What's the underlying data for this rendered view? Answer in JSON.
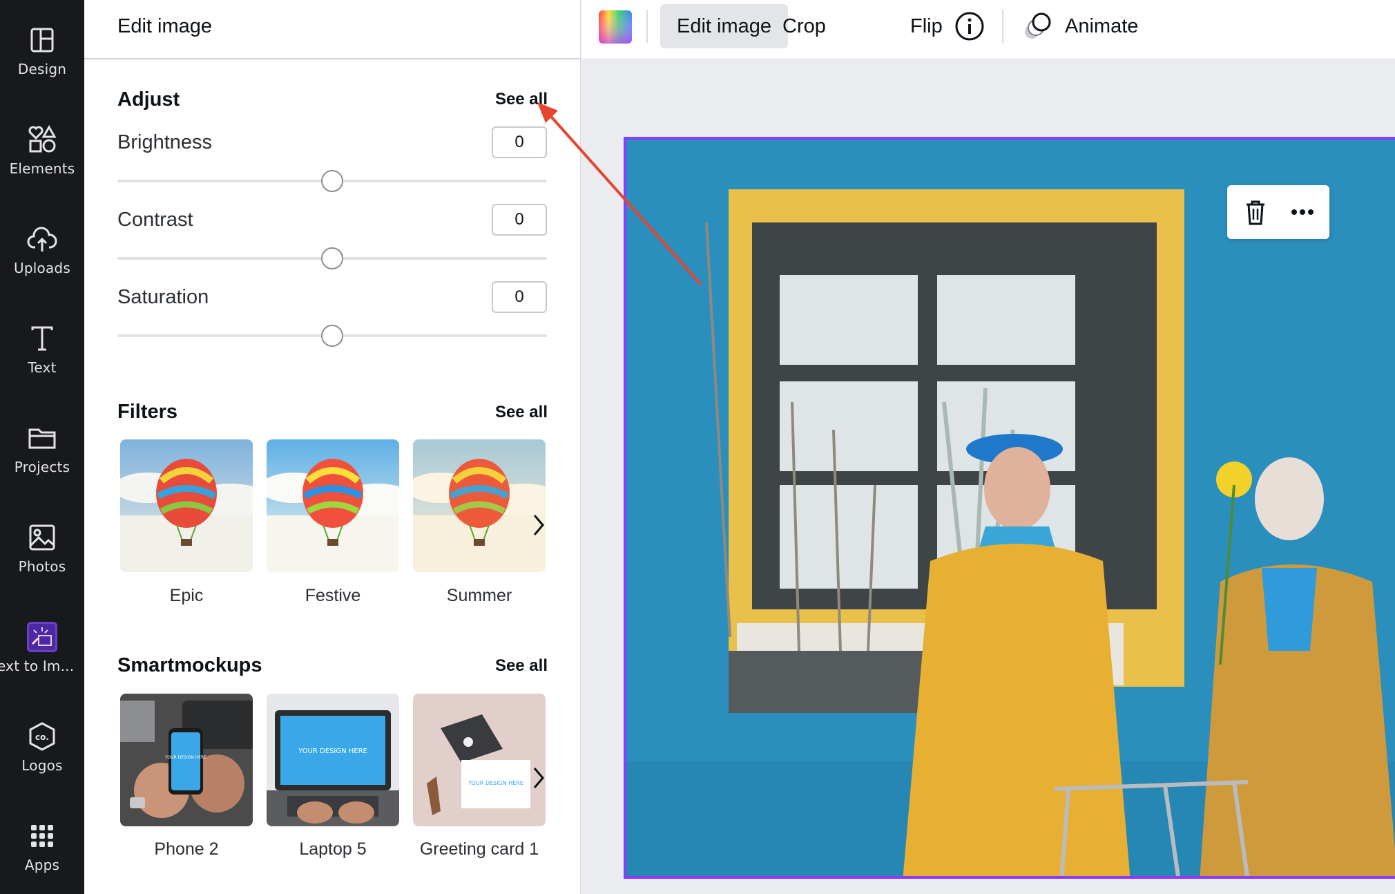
{
  "rail": {
    "items": [
      {
        "label": "Design",
        "icon": "layout-icon"
      },
      {
        "label": "Elements",
        "icon": "elements-icon"
      },
      {
        "label": "Uploads",
        "icon": "cloud-upload-icon"
      },
      {
        "label": "Text",
        "icon": "text-icon"
      },
      {
        "label": "Projects",
        "icon": "folder-icon"
      },
      {
        "label": "Photos",
        "icon": "photo-icon"
      },
      {
        "label": "ext to Im...",
        "icon": "text-to-image-app-icon"
      },
      {
        "label": "Logos",
        "icon": "logo-co-icon"
      },
      {
        "label": "Apps",
        "icon": "apps-grid-icon"
      }
    ]
  },
  "panel": {
    "title": "Edit image",
    "adjust": {
      "title": "Adjust",
      "see_all": "See all",
      "controls": [
        {
          "label": "Brightness",
          "value": "0",
          "level": 0.5
        },
        {
          "label": "Contrast",
          "value": "0",
          "level": 0.5
        },
        {
          "label": "Saturation",
          "value": "0",
          "level": 0.5
        }
      ]
    },
    "filters": {
      "title": "Filters",
      "see_all": "See all",
      "items": [
        {
          "label": "Epic"
        },
        {
          "label": "Festive"
        },
        {
          "label": "Summer"
        }
      ]
    },
    "smartmockups": {
      "title": "Smartmockups",
      "see_all": "See all",
      "items": [
        {
          "label": "Phone 2",
          "mock_text": "YOUR DESIGN HERE"
        },
        {
          "label": "Laptop 5",
          "mock_text": "YOUR DESIGN HERE"
        },
        {
          "label": "Greeting card 1",
          "mock_text": "YOUR DESIGN HERE"
        }
      ]
    }
  },
  "toolbar": {
    "color_icon": "color-wheel-icon",
    "edit_image": "Edit image",
    "crop": "Crop",
    "flip": "Flip",
    "info_icon": "info-icon",
    "animate": "Animate"
  },
  "canvas": {
    "float_actions": [
      "trash-icon",
      "more-icon"
    ]
  },
  "colors": {
    "accent": "#8b3dff",
    "rail_bg": "#18191b",
    "annotation_arrow": "#e5452f",
    "wall_blue": "#2a8fbd",
    "frame_yellow": "#e9c04a"
  }
}
